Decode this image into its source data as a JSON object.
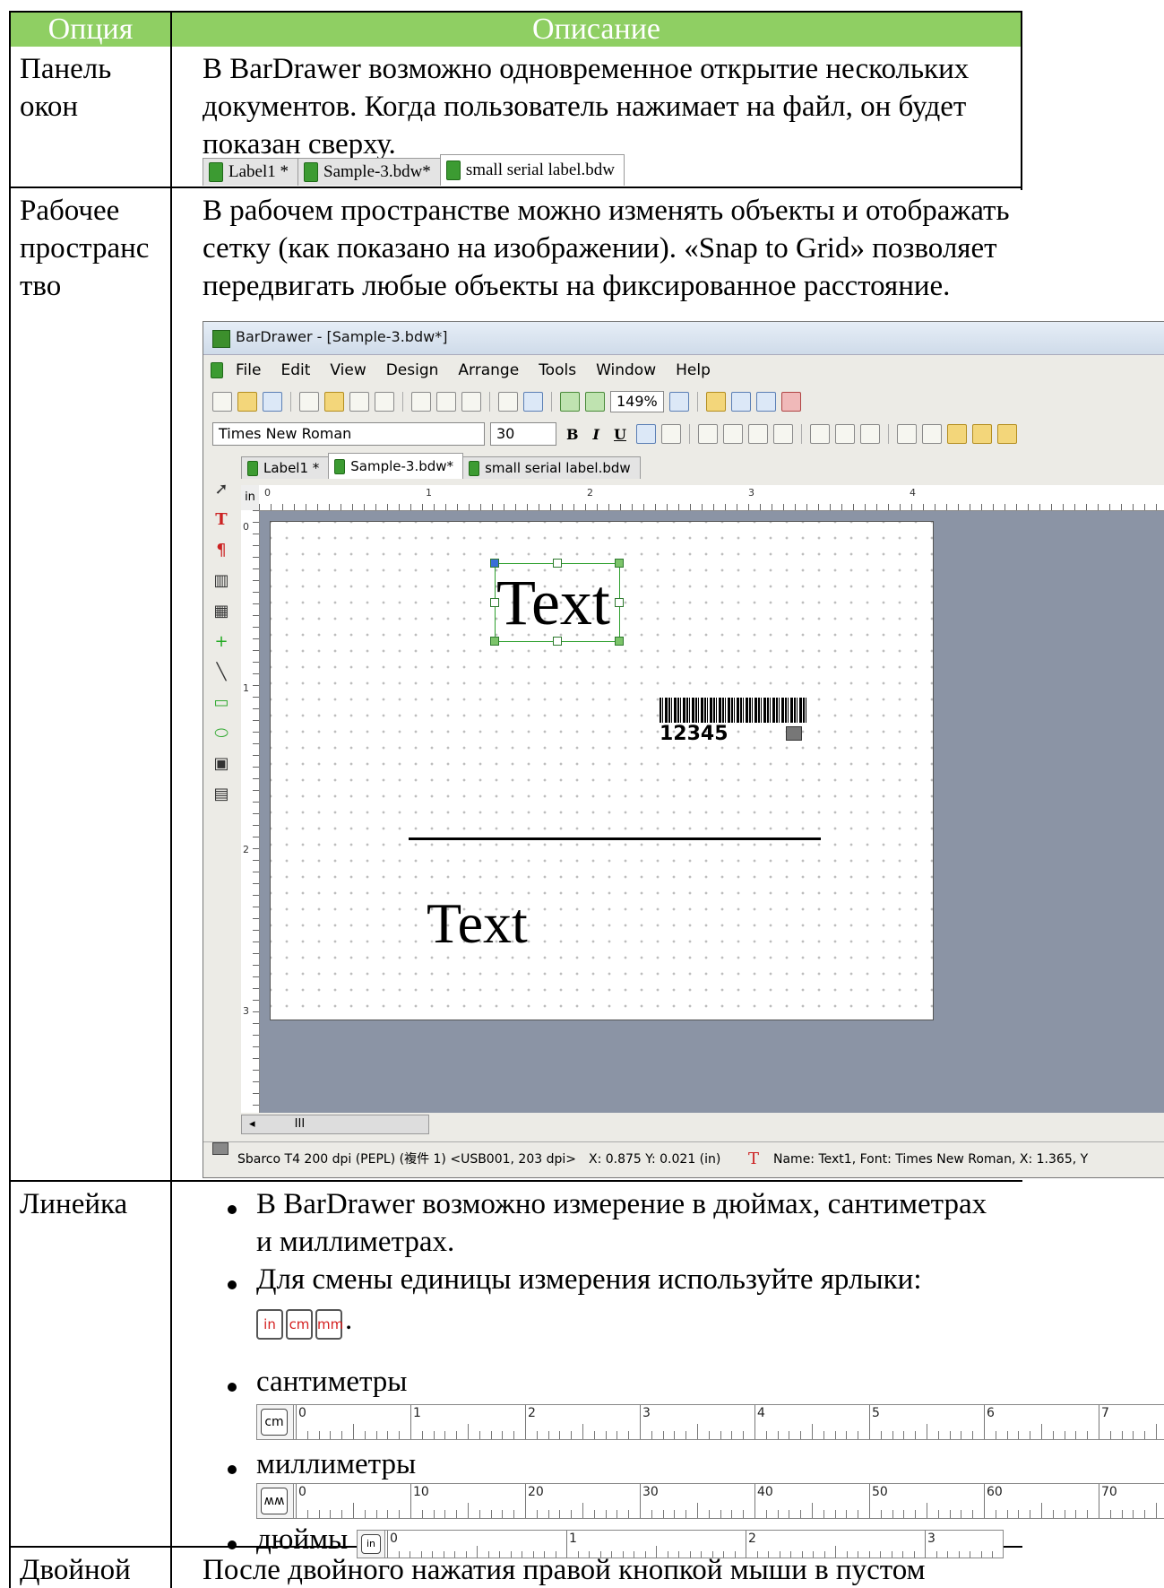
{
  "table": {
    "headers": [
      "Опция",
      "Описание"
    ],
    "rows": {
      "windows_panel": {
        "option": [
          "Панель",
          "окон"
        ],
        "description": [
          "В BarDrawer возможно одновременное открытие нескольких",
          "документов. Когда пользователь нажимает на файл, он будет",
          "показан сверху."
        ]
      },
      "workspace": {
        "option": [
          "Рабочее",
          "пространс",
          "тво"
        ],
        "description": [
          "В рабочем пространстве можно изменять объекты и отображать",
          "сетку (как показано на изображении). «Snap to Grid» позволяет",
          "передвигать любые объекты на фиксированное расстояние."
        ]
      },
      "ruler": {
        "option": [
          "Линейка"
        ],
        "bullets": [
          "В BarDrawer возможно измерение в дюймах, сантиметрах",
          "и миллиметрах.",
          "Для смены единицы измерения используйте ярлыки:",
          "сантиметры",
          "миллиметры",
          "дюймы"
        ]
      },
      "double_click": {
        "option": [
          "Двойной"
        ],
        "description": [
          "После двойного нажатия правой кнопкой мыши в пустом"
        ]
      }
    }
  },
  "doc_tabs": [
    "Label1 *",
    "Sample-3.bdw*",
    "small serial label.bdw"
  ],
  "app": {
    "title": "BarDrawer - [Sample-3.bdw*]",
    "menu": [
      "File",
      "Edit",
      "View",
      "Design",
      "Arrange",
      "Tools",
      "Window",
      "Help"
    ],
    "zoom": "149%",
    "font_name": "Times New Roman",
    "font_size": "30",
    "format_buttons": [
      "B",
      "I",
      "U"
    ],
    "tabs": [
      "Label1 *",
      "Sample-3.bdw*",
      "small serial label.bdw"
    ],
    "ruler_unit": "in",
    "h_ruler_labels": [
      "0",
      "1",
      "2",
      "3",
      "4"
    ],
    "v_ruler_labels": [
      "0",
      "1",
      "2",
      "3"
    ],
    "label_objects": {
      "text1": "Text",
      "text2": "Text",
      "barcode_number": "12345"
    },
    "scroll_label": "III",
    "status": {
      "printer": "Sbarco T4 200 dpi (PEPL) (複件 1) <USB001, 203 dpi>",
      "coords": "X: 0.875  Y: 0.021 (in)",
      "object_info": "Name: Text1, Font: Times New Roman, X: 1.365, Y"
    }
  },
  "unit_buttons": [
    "in",
    "cm",
    "mm"
  ],
  "unit_buttons_suffix": ".",
  "cm_ruler": {
    "unit": "cm",
    "labels": [
      "0",
      "1",
      "2",
      "3",
      "4",
      "5",
      "6",
      "7"
    ]
  },
  "mm_ruler": {
    "unit": "ww",
    "labels": [
      "0",
      "10",
      "20",
      "30",
      "40",
      "50",
      "60",
      "70"
    ]
  },
  "inch_ruler": {
    "unit": "in",
    "labels": [
      "0",
      "1",
      "2",
      "3"
    ]
  },
  "colors": {
    "header_green": "#8fcf63",
    "unit_red": "#d41f1f",
    "canvas_bg": "#8b94a5"
  }
}
